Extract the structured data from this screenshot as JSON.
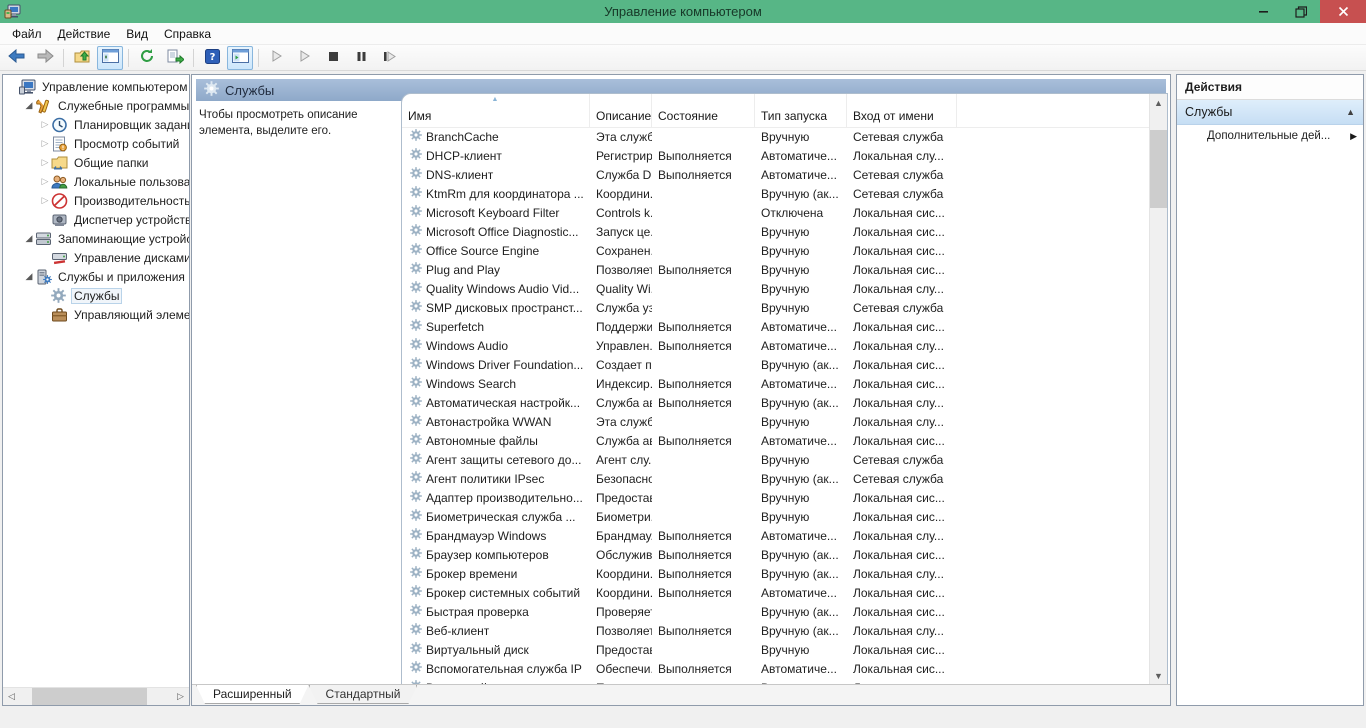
{
  "window": {
    "title": "Управление компьютером",
    "controls": {
      "minimize": "minimize",
      "restore": "restore",
      "close": "close"
    }
  },
  "menu": {
    "items": [
      "Файл",
      "Действие",
      "Вид",
      "Справка"
    ]
  },
  "toolbar": {
    "buttons": [
      {
        "name": "back-button",
        "icon": "arrow-left-icon",
        "active": false
      },
      {
        "name": "forward-button",
        "icon": "arrow-right-icon",
        "active": false
      },
      {
        "name": "sep"
      },
      {
        "name": "up-one-level-button",
        "icon": "folder-up-icon",
        "active": false
      },
      {
        "name": "show-console-tree-button",
        "icon": "console-tree-icon",
        "active": true
      },
      {
        "name": "sep"
      },
      {
        "name": "refresh-button",
        "icon": "refresh-icon",
        "active": false
      },
      {
        "name": "export-list-button",
        "icon": "export-list-icon",
        "active": false
      },
      {
        "name": "sep"
      },
      {
        "name": "help-button",
        "icon": "help-icon",
        "active": false
      },
      {
        "name": "show-action-pane-button",
        "icon": "action-pane-icon",
        "active": true
      },
      {
        "name": "sep"
      },
      {
        "name": "start-service-button",
        "icon": "play-disabled-icon",
        "active": false
      },
      {
        "name": "resume-service-button",
        "icon": "play-disabled-icon",
        "active": false
      },
      {
        "name": "stop-service-button",
        "icon": "stop-icon",
        "active": false
      },
      {
        "name": "pause-service-button",
        "icon": "pause-icon",
        "active": false
      },
      {
        "name": "restart-service-button",
        "icon": "restart-icon",
        "active": false
      }
    ]
  },
  "tree": {
    "items": [
      {
        "label": "Управление компьютером (л",
        "icon": "computer-icon",
        "level": 0,
        "expander": "none",
        "selected": false
      },
      {
        "label": "Служебные программы",
        "icon": "system-tools-icon",
        "level": 1,
        "expander": "expanded",
        "selected": false
      },
      {
        "label": "Планировщик заданий",
        "icon": "task-scheduler-icon",
        "level": 2,
        "expander": "collapsed",
        "selected": false
      },
      {
        "label": "Просмотр событий",
        "icon": "event-viewer-icon",
        "level": 2,
        "expander": "collapsed",
        "selected": false
      },
      {
        "label": "Общие папки",
        "icon": "shared-folders-icon",
        "level": 2,
        "expander": "collapsed",
        "selected": false
      },
      {
        "label": "Локальные пользовате",
        "icon": "local-users-icon",
        "level": 2,
        "expander": "collapsed",
        "selected": false
      },
      {
        "label": "Производительность",
        "icon": "performance-icon",
        "level": 2,
        "expander": "collapsed",
        "selected": false
      },
      {
        "label": "Диспетчер устройств",
        "icon": "device-manager-icon",
        "level": 2,
        "expander": "none",
        "selected": false
      },
      {
        "label": "Запоминающие устройст",
        "icon": "storage-icon",
        "level": 1,
        "expander": "expanded",
        "selected": false
      },
      {
        "label": "Управление дисками",
        "icon": "disk-management-icon",
        "level": 2,
        "expander": "none",
        "selected": false
      },
      {
        "label": "Службы и приложения",
        "icon": "services-apps-icon",
        "level": 1,
        "expander": "expanded",
        "selected": false
      },
      {
        "label": "Службы",
        "icon": "services-icon",
        "level": 2,
        "expander": "none",
        "selected": true
      },
      {
        "label": "Управляющий элемен",
        "icon": "wmi-control-icon",
        "level": 2,
        "expander": "none",
        "selected": false
      }
    ]
  },
  "middle": {
    "header_title": "Службы",
    "description_line1": "Чтобы просмотреть описание",
    "description_line2": "элемента, выделите его."
  },
  "table": {
    "columns": [
      {
        "label": "Имя",
        "sort": "asc"
      },
      {
        "label": "Описание",
        "sort": null
      },
      {
        "label": "Состояние",
        "sort": null
      },
      {
        "label": "Тип запуска",
        "sort": null
      },
      {
        "label": "Вход от имени",
        "sort": null
      },
      {
        "label": "",
        "sort": null
      }
    ],
    "rows": [
      {
        "name": "BranchCache",
        "description": "Эта служб...",
        "status": "",
        "startup": "Вручную",
        "logon": "Сетевая служба"
      },
      {
        "name": "DHCP-клиент",
        "description": "Регистрир...",
        "status": "Выполняется",
        "startup": "Автоматиче...",
        "logon": "Локальная слу..."
      },
      {
        "name": "DNS-клиент",
        "description": "Служба D...",
        "status": "Выполняется",
        "startup": "Автоматиче...",
        "logon": "Сетевая служба"
      },
      {
        "name": "KtmRm для координатора ...",
        "description": "Координи...",
        "status": "",
        "startup": "Вручную (ак...",
        "logon": "Сетевая служба"
      },
      {
        "name": "Microsoft Keyboard Filter",
        "description": "Controls k...",
        "status": "",
        "startup": "Отключена",
        "logon": "Локальная сис..."
      },
      {
        "name": "Microsoft Office Diagnostic...",
        "description": "Запуск це...",
        "status": "",
        "startup": "Вручную",
        "logon": "Локальная сис..."
      },
      {
        "name": "Office Source Engine",
        "description": "Сохранен...",
        "status": "",
        "startup": "Вручную",
        "logon": "Локальная сис..."
      },
      {
        "name": "Plug and Play",
        "description": "Позволяет...",
        "status": "Выполняется",
        "startup": "Вручную",
        "logon": "Локальная сис..."
      },
      {
        "name": "Quality Windows Audio Vid...",
        "description": "Quality Wi...",
        "status": "",
        "startup": "Вручную",
        "logon": "Локальная слу..."
      },
      {
        "name": "SMP дисковых пространст...",
        "description": "Служба уз...",
        "status": "",
        "startup": "Вручную",
        "logon": "Сетевая служба"
      },
      {
        "name": "Superfetch",
        "description": "Поддержи...",
        "status": "Выполняется",
        "startup": "Автоматиче...",
        "logon": "Локальная сис..."
      },
      {
        "name": "Windows Audio",
        "description": "Управлен...",
        "status": "Выполняется",
        "startup": "Автоматиче...",
        "logon": "Локальная слу..."
      },
      {
        "name": "Windows Driver Foundation...",
        "description": "Создает п...",
        "status": "",
        "startup": "Вручную (ак...",
        "logon": "Локальная сис..."
      },
      {
        "name": "Windows Search",
        "description": "Индексир...",
        "status": "Выполняется",
        "startup": "Автоматиче...",
        "logon": "Локальная сис..."
      },
      {
        "name": "Автоматическая настройк...",
        "description": "Служба ав...",
        "status": "Выполняется",
        "startup": "Вручную (ак...",
        "logon": "Локальная слу..."
      },
      {
        "name": "Автонастройка WWAN",
        "description": "Эта служб...",
        "status": "",
        "startup": "Вручную",
        "logon": "Локальная слу..."
      },
      {
        "name": "Автономные файлы",
        "description": "Служба ав...",
        "status": "Выполняется",
        "startup": "Автоматиче...",
        "logon": "Локальная сис..."
      },
      {
        "name": "Агент защиты сетевого до...",
        "description": "Агент слу...",
        "status": "",
        "startup": "Вручную",
        "logon": "Сетевая служба"
      },
      {
        "name": "Агент политики IPsec",
        "description": "Безопасно...",
        "status": "",
        "startup": "Вручную (ак...",
        "logon": "Сетевая служба"
      },
      {
        "name": "Адаптер производительно...",
        "description": "Предостав...",
        "status": "",
        "startup": "Вручную",
        "logon": "Локальная сис..."
      },
      {
        "name": "Биометрическая служба ...",
        "description": "Биометри...",
        "status": "",
        "startup": "Вручную",
        "logon": "Локальная сис..."
      },
      {
        "name": "Брандмауэр Windows",
        "description": "Брандмау...",
        "status": "Выполняется",
        "startup": "Автоматиче...",
        "logon": "Локальная слу..."
      },
      {
        "name": "Браузер компьютеров",
        "description": "Обслужив...",
        "status": "Выполняется",
        "startup": "Вручную (ак...",
        "logon": "Локальная сис..."
      },
      {
        "name": "Брокер времени",
        "description": "Координи...",
        "status": "Выполняется",
        "startup": "Вручную (ак...",
        "logon": "Локальная слу..."
      },
      {
        "name": "Брокер системных событий",
        "description": "Координи...",
        "status": "Выполняется",
        "startup": "Автоматиче...",
        "logon": "Локальная сис..."
      },
      {
        "name": "Быстрая проверка",
        "description": "Проверяет...",
        "status": "",
        "startup": "Вручную (ак...",
        "logon": "Локальная сис..."
      },
      {
        "name": "Веб-клиент",
        "description": "Позволяет...",
        "status": "Выполняется",
        "startup": "Вручную (ак...",
        "logon": "Локальная слу..."
      },
      {
        "name": "Виртуальный диск",
        "description": "Предостав...",
        "status": "",
        "startup": "Вручную",
        "logon": "Локальная сис..."
      },
      {
        "name": "Вспомогательная служба IP",
        "description": "Обеспечи...",
        "status": "Выполняется",
        "startup": "Автоматиче...",
        "logon": "Локальная сис..."
      },
      {
        "name": "Вторичный вход в систему",
        "description": "Позволяет...",
        "status": "",
        "startup": "Вручную",
        "logon": "Локальная сис...",
        "clipped": true
      }
    ]
  },
  "tabs": [
    {
      "label": "Расширенный",
      "active": true
    },
    {
      "label": "Стандартный",
      "active": false
    }
  ],
  "actions": {
    "title": "Действия",
    "section_label": "Службы",
    "section_state": "expanded",
    "items": [
      {
        "label": "Дополнительные дей...",
        "submenu": true
      }
    ]
  },
  "colors": {
    "titlebar": "#57b686",
    "close_button": "#c75050",
    "result_header_top": "#a9bfda",
    "result_header_bottom": "#8ea9c9",
    "actions_section_top": "#dfeefb",
    "actions_section_bottom": "#c6def4",
    "scroll_thumb": "#cdcdcd"
  }
}
